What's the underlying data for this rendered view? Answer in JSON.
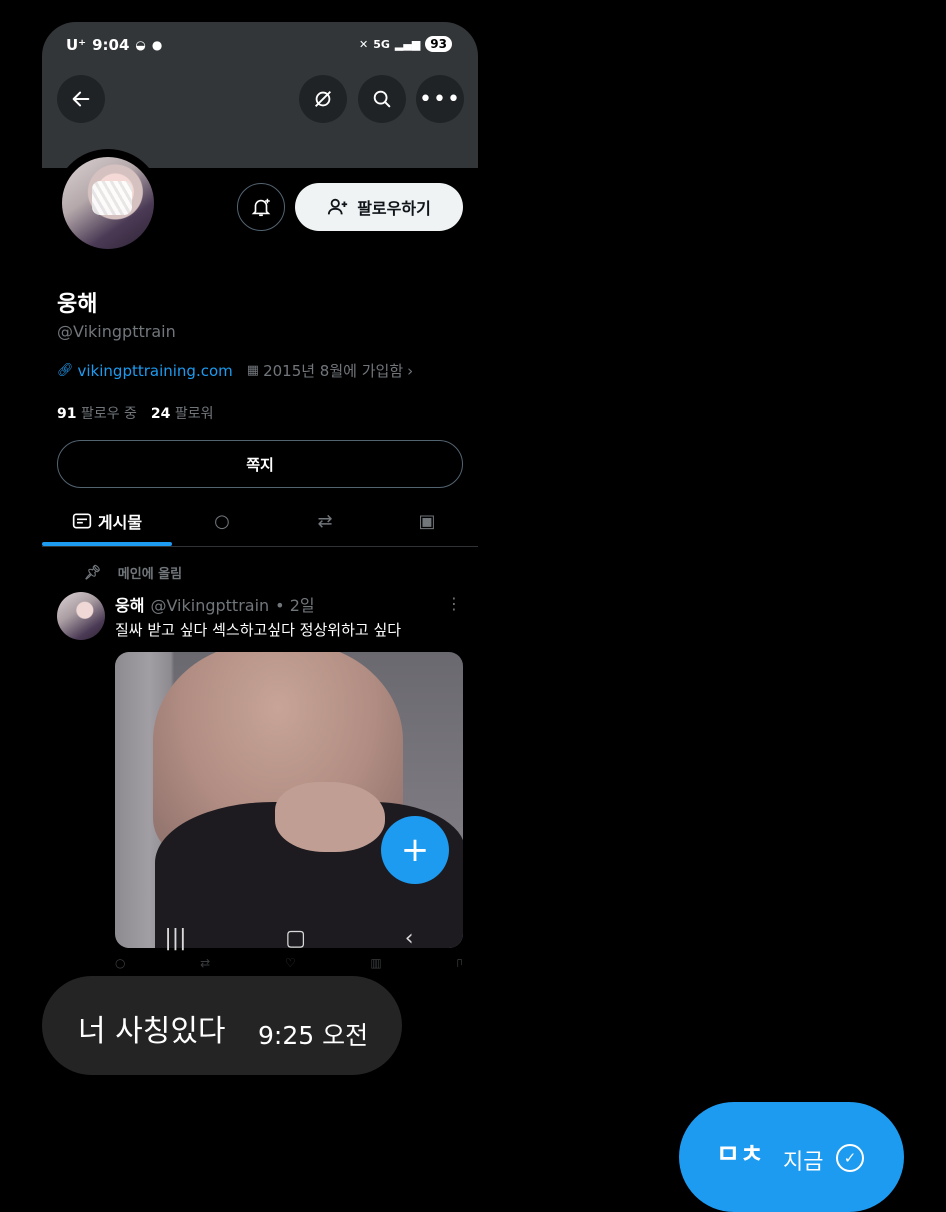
{
  "status_bar": {
    "carrier": "U⁺",
    "time": "9:04",
    "network": "5G",
    "battery": "93"
  },
  "profile": {
    "name": "웅해",
    "handle": "@Vikingpttrain",
    "website": "vikingpttraining.com",
    "joined": "2015년 8월에 가입함",
    "following_count": "91",
    "following_label": "팔로우 중",
    "followers_count": "24",
    "followers_label": "팔로워",
    "follow_label": "팔로우하기",
    "message_label": "쪽지"
  },
  "tabs": {
    "posts_label": "게시물"
  },
  "tweet": {
    "pinned_label": "메인에 올림",
    "name": "웅해",
    "handle": "@Vikingpttrain",
    "time": "• 2일",
    "text": "질싸 받고 싶다  섹스하고싶다 정상위하고 싶다"
  },
  "chat": {
    "received_text": "너 사칭있다",
    "received_time": "9:25 오전",
    "sent_text": "ㅁㅊ",
    "sent_time": "지금"
  },
  "colors": {
    "accent": "#1d9bf0",
    "banner": "#333639",
    "received_bubble": "#242424"
  },
  "icons": [
    "back-arrow-icon",
    "sync-off-icon",
    "search-icon",
    "more-icon",
    "bell-plus-icon",
    "add-person-icon",
    "link-icon",
    "calendar-icon",
    "chevron-right-icon",
    "posts-tab-icon",
    "reply-icon",
    "retweet-icon",
    "media-icon",
    "pin-icon",
    "plus-icon",
    "check-circle-icon"
  ]
}
